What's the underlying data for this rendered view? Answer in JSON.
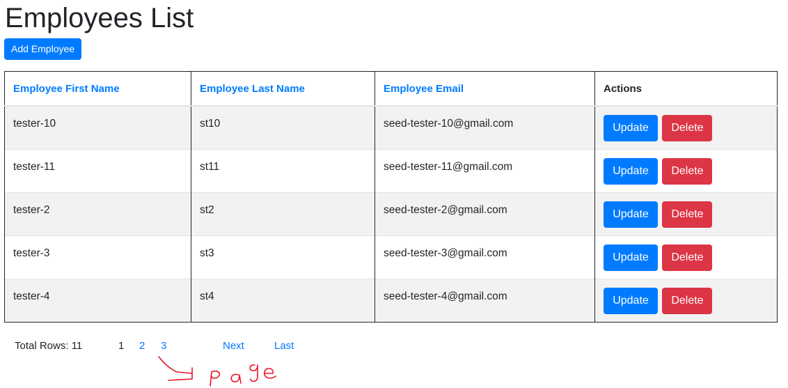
{
  "header": {
    "title": "Employees List",
    "add_button_label": "Add Employee"
  },
  "table": {
    "columns": [
      "Employee First Name",
      "Employee Last Name",
      "Employee Email",
      "Actions"
    ],
    "rows": [
      {
        "first_name": "tester-10",
        "last_name": "st10",
        "email": "seed-tester-10@gmail.com"
      },
      {
        "first_name": "tester-11",
        "last_name": "st11",
        "email": "seed-tester-11@gmail.com"
      },
      {
        "first_name": "tester-2",
        "last_name": "st2",
        "email": "seed-tester-2@gmail.com"
      },
      {
        "first_name": "tester-3",
        "last_name": "st3",
        "email": "seed-tester-3@gmail.com"
      },
      {
        "first_name": "tester-4",
        "last_name": "st4",
        "email": "seed-tester-4@gmail.com"
      }
    ],
    "update_label": "Update",
    "delete_label": "Delete"
  },
  "pagination": {
    "total_rows_label": "Total Rows: 11",
    "pages": [
      "1",
      "2",
      "3"
    ],
    "current_page": "1",
    "next_label": "Next",
    "last_label": "Last"
  },
  "colors": {
    "primary": "#007bff",
    "danger": "#dc3545",
    "annotation": "#e8142a"
  }
}
